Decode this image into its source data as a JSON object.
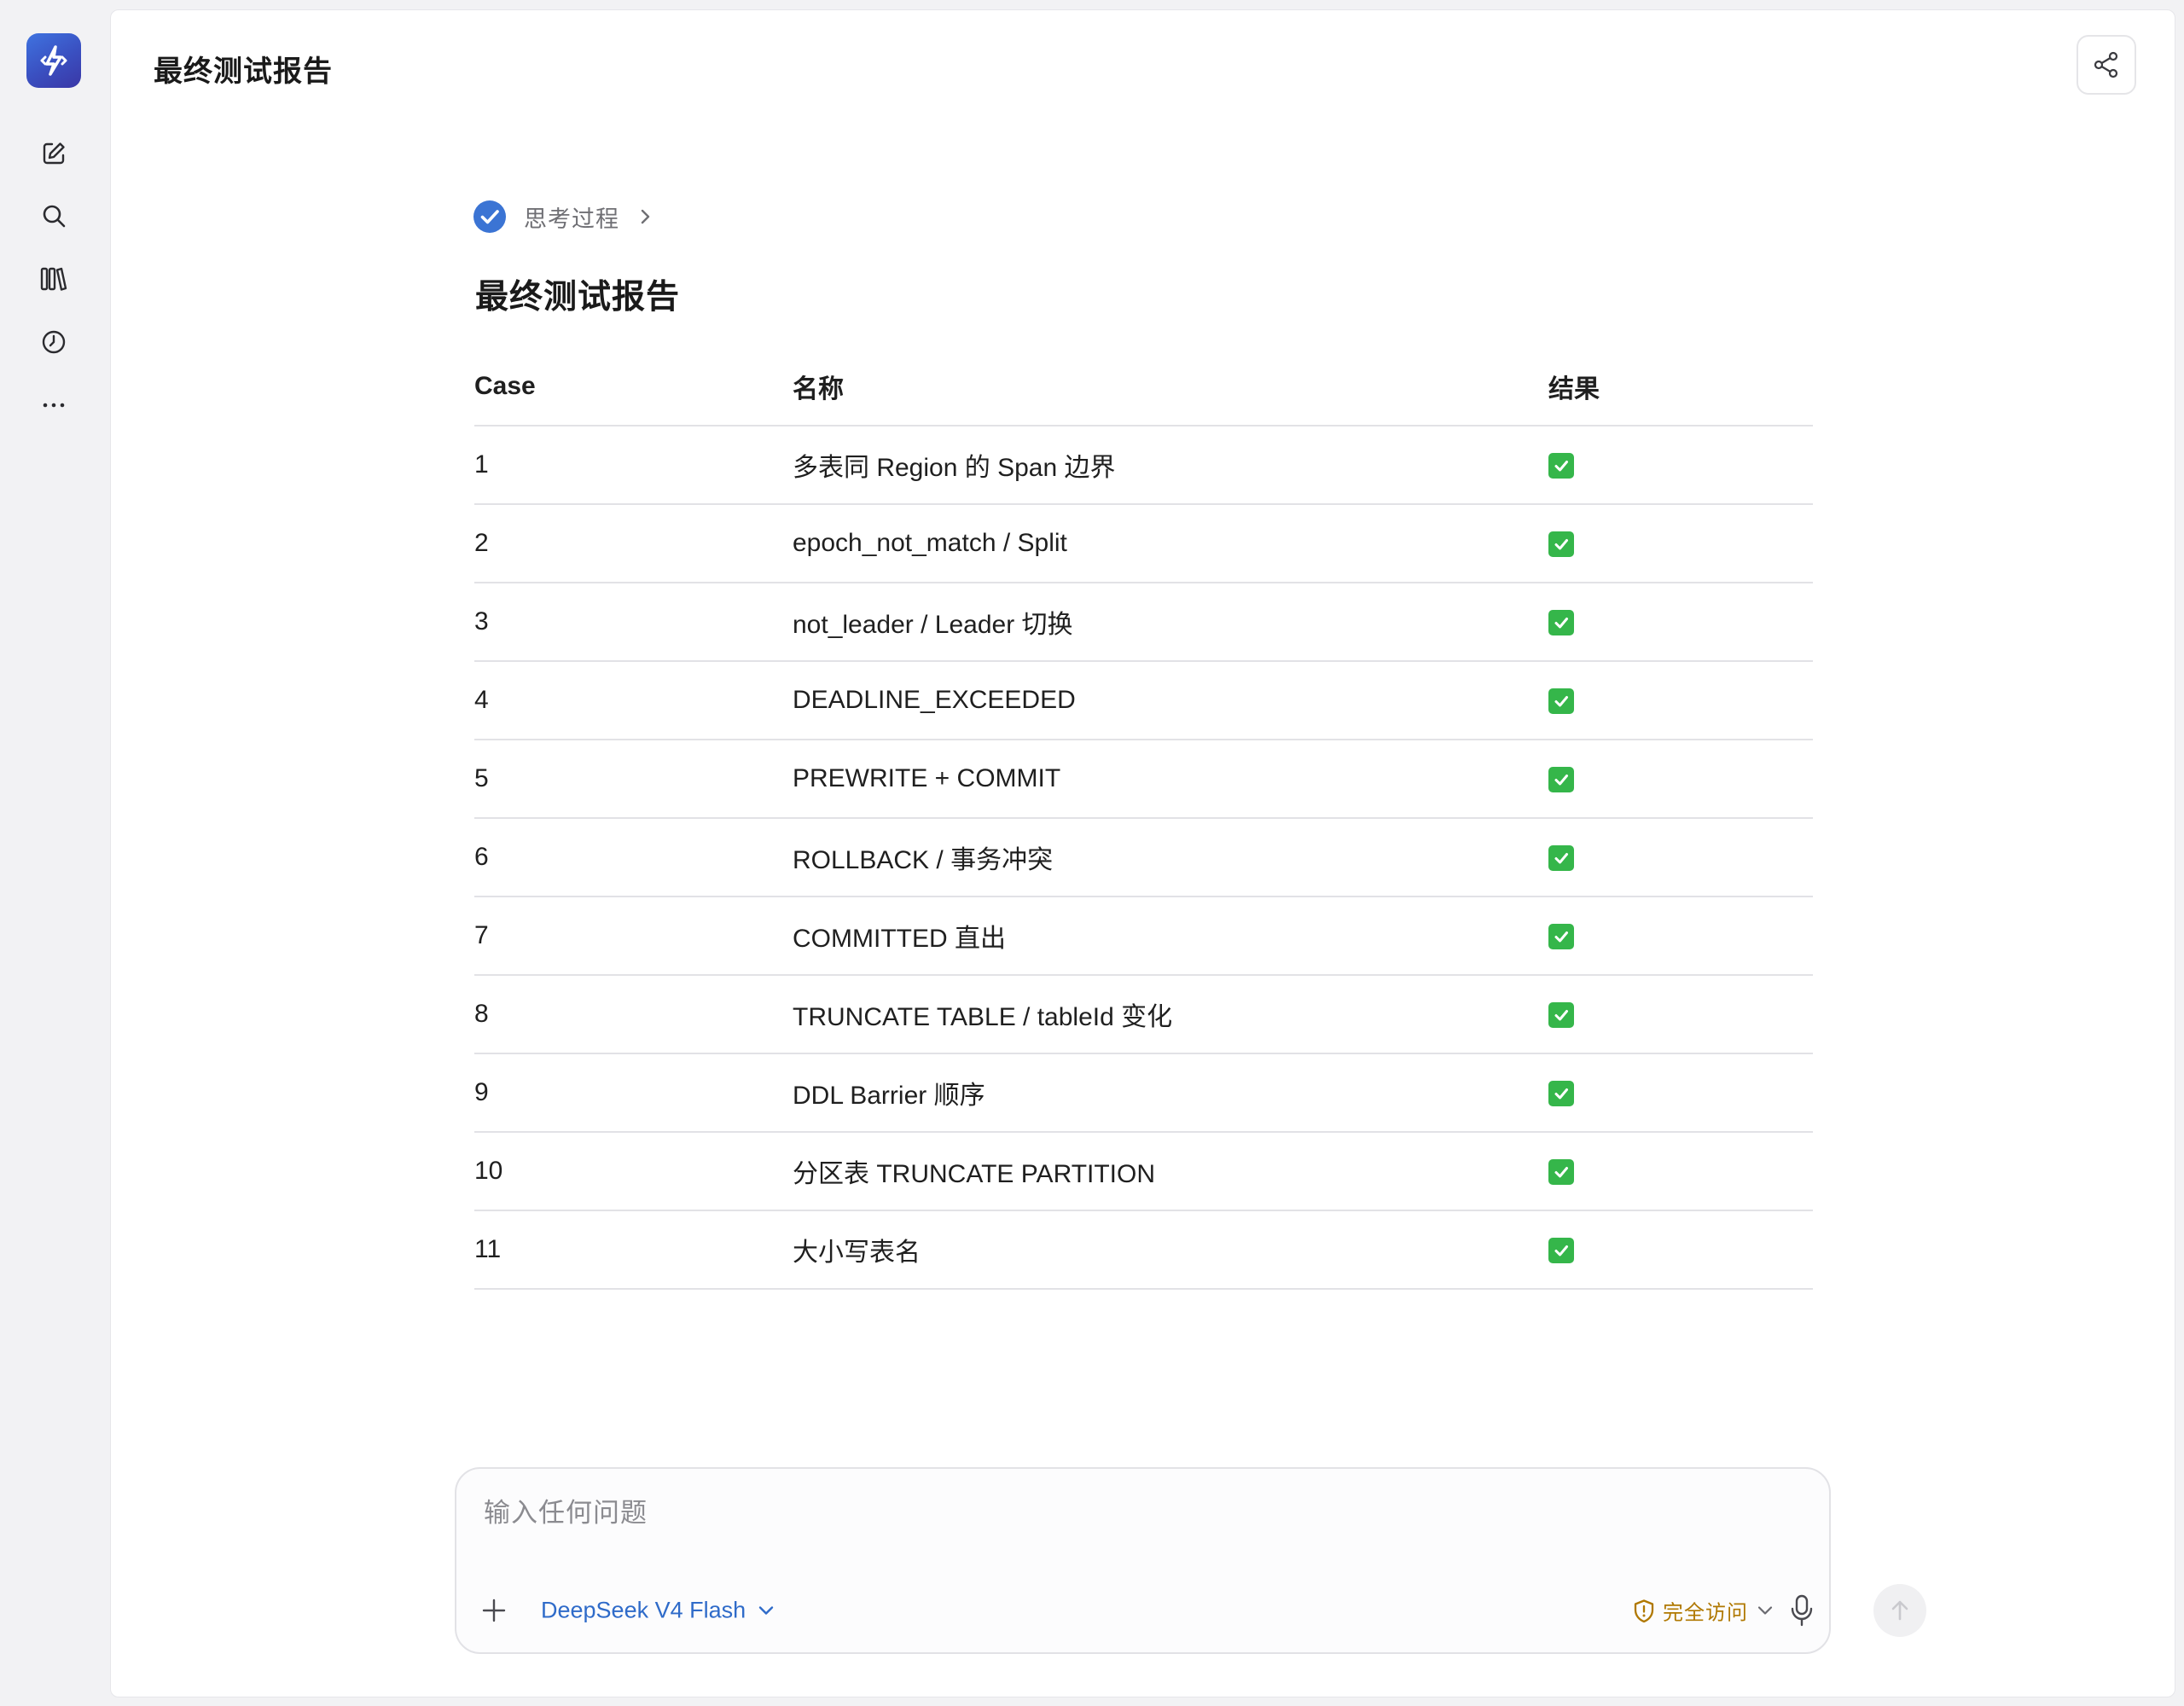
{
  "header": {
    "title": "最终测试报告"
  },
  "rail": {
    "items": [
      {
        "icon": "new-chat-icon"
      },
      {
        "icon": "search-icon"
      },
      {
        "icon": "library-icon"
      },
      {
        "icon": "history-icon"
      },
      {
        "icon": "more-icon"
      }
    ]
  },
  "thinking": {
    "label": "思考过程"
  },
  "report": {
    "title": "最终测试报告",
    "columns": [
      "Case",
      "名称",
      "结果"
    ],
    "rows": [
      {
        "case": "1",
        "name": "多表同 Region 的 Span 边界",
        "result": "✅"
      },
      {
        "case": "2",
        "name": "epoch_not_match / Split",
        "result": "✅"
      },
      {
        "case": "3",
        "name": "not_leader / Leader 切换",
        "result": "✅"
      },
      {
        "case": "4",
        "name": "DEADLINE_EXCEEDED",
        "result": "✅"
      },
      {
        "case": "5",
        "name": "PREWRITE + COMMIT",
        "result": "✅"
      },
      {
        "case": "6",
        "name": "ROLLBACK / 事务冲突",
        "result": "✅"
      },
      {
        "case": "7",
        "name": "COMMITTED 直出",
        "result": "✅"
      },
      {
        "case": "8",
        "name": "TRUNCATE TABLE / tableId 变化",
        "result": "✅"
      },
      {
        "case": "9",
        "name": "DDL Barrier 顺序",
        "result": "✅"
      },
      {
        "case": "10",
        "name": "分区表 TRUNCATE PARTITION",
        "result": "✅"
      },
      {
        "case": "11",
        "name": "大小写表名",
        "result": "✅"
      }
    ]
  },
  "composer": {
    "placeholder": "输入任何问题",
    "value": "",
    "model": "DeepSeek V4 Flash",
    "access": "完全访问"
  },
  "colors": {
    "accent": "#2f6bc9",
    "warning": "#b07800",
    "success": "#35b64a"
  }
}
